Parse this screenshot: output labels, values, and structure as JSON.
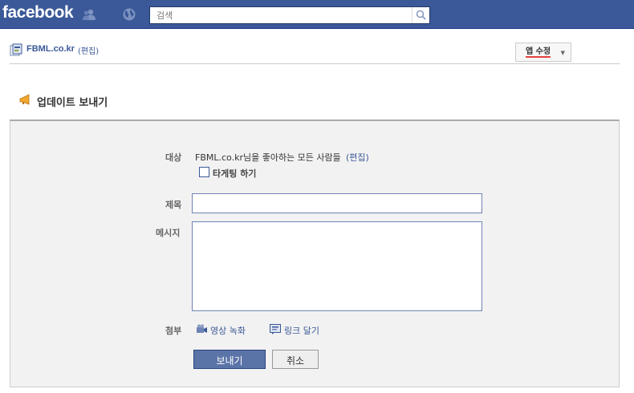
{
  "topbar": {
    "logo": "facebook",
    "search_placeholder": "검색"
  },
  "page_header": {
    "page_name": "FBML.co.kr",
    "edit_link": "(편집)",
    "edit_app_label": "앱 수정",
    "edit_app_arrow": "▼"
  },
  "section": {
    "title": "업데이트 보내기"
  },
  "form": {
    "to_label": "대상",
    "to_text": "FBML.co.kr님을 좋아하는 모든 사람들",
    "to_edit": "(편집)",
    "targeting_label": "타게팅 하기",
    "subject_label": "제목",
    "subject_value": "",
    "message_label": "메시지",
    "message_value": "",
    "attach_label": "첨부",
    "attach_video": "영상 녹화",
    "attach_link": "링크 달기",
    "send_label": "보내기",
    "cancel_label": "취소"
  },
  "icons": {
    "friends": "friends-icon",
    "notifications": "globe-icon",
    "search": "search-icon",
    "page": "page-icon",
    "megaphone": "megaphone-icon",
    "video": "video-camera-icon",
    "link": "link-icon"
  },
  "colors": {
    "brand": "#3b5998",
    "brand_dark": "#29447e",
    "panel_bg": "#f2f2f2",
    "accent_underline": "#e3423a"
  }
}
